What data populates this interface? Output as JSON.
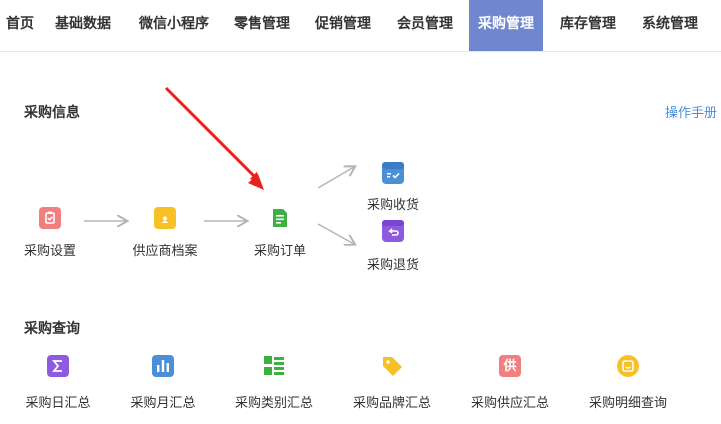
{
  "nav": {
    "items": [
      {
        "label": "首页"
      },
      {
        "label": "基础数据"
      },
      {
        "label": "微信小程序"
      },
      {
        "label": "零售管理"
      },
      {
        "label": "促销管理"
      },
      {
        "label": "会员管理"
      },
      {
        "label": "采购管理",
        "active": true
      },
      {
        "label": "库存管理"
      },
      {
        "label": "系统管理"
      }
    ]
  },
  "info": {
    "title": "采购信息",
    "manual_link": "操作手册",
    "nodes": {
      "setup": {
        "label": "采购设置",
        "icon": "clipboard-icon",
        "color": "#f08080"
      },
      "supplier": {
        "label": "供应商档案",
        "icon": "folder-user-icon",
        "color": "#f6c026"
      },
      "order": {
        "label": "采购订单",
        "icon": "document-icon",
        "color": "#3cb043"
      },
      "receive": {
        "label": "采购收货",
        "icon": "inbox-check-icon",
        "color": "#4a8fd8"
      },
      "return": {
        "label": "采购退货",
        "icon": "return-box-icon",
        "color": "#8e5ae0"
      }
    }
  },
  "query": {
    "title": "采购查询",
    "items": [
      {
        "label": "采购日汇总",
        "icon": "sigma-icon",
        "color": "#8e5ae0"
      },
      {
        "label": "采购月汇总",
        "icon": "bar-chart-icon",
        "color": "#4a8fd8"
      },
      {
        "label": "采购类别汇总",
        "icon": "list-icon",
        "color": "#3cb043"
      },
      {
        "label": "采购品牌汇总",
        "icon": "tag-icon",
        "color": "#f6c026"
      },
      {
        "label": "采购供应汇总",
        "icon": "supply-badge-icon",
        "color": "#f08080",
        "glyph": "供"
      },
      {
        "label": "采购明细查询",
        "icon": "smiley-badge-icon",
        "color": "#f6c026"
      }
    ]
  },
  "annotation": {
    "arrow_color": "#e8231f"
  }
}
